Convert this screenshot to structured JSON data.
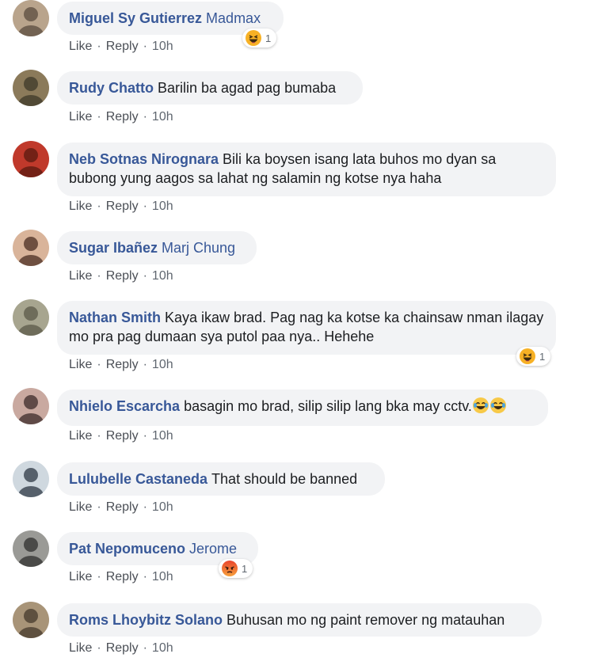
{
  "comments": [
    {
      "name": "Miguel Sy Gutierrez",
      "mention": "Madmax",
      "text": "",
      "like": "Like",
      "reply": "Reply",
      "time": "10h",
      "reaction": {
        "type": "haha",
        "count": "1"
      },
      "avatar_colors": [
        "#b9a48c",
        "#5b4c3f"
      ]
    },
    {
      "name": "Rudy Chatto",
      "mention": "",
      "text": "Barilin ba agad pag bumaba",
      "like": "Like",
      "reply": "Reply",
      "time": "10h",
      "avatar_colors": [
        "#8b7a5a",
        "#3e3a2a"
      ]
    },
    {
      "name": "Neb Sotnas Nirognara",
      "mention": "",
      "text": "Bili ka boysen isang lata buhos mo dyan sa bubong yung aagos sa lahat ng salamin ng kotse nya haha",
      "like": "Like",
      "reply": "Reply",
      "time": "10h",
      "avatar_colors": [
        "#c0392b",
        "#5a1a10"
      ]
    },
    {
      "name": "Sugar Ibañez",
      "mention": "Marj Chung",
      "text": "",
      "like": "Like",
      "reply": "Reply",
      "time": "10h",
      "avatar_colors": [
        "#d9b49a",
        "#4a2e22"
      ]
    },
    {
      "name": "Nathan Smith",
      "mention": "",
      "text": "Kaya ikaw brad. Pag nag ka kotse ka chainsaw nman ilagay mo pra pag dumaan sya putol paa nya.. Hehehe",
      "like": "Like",
      "reply": "Reply",
      "time": "10h",
      "reaction": {
        "type": "haha",
        "count": "1"
      },
      "avatar_colors": [
        "#a7a58f",
        "#5b5a48"
      ]
    },
    {
      "name": "Nhielo Escarcha",
      "mention": "",
      "text": "basagin mo brad, silip silip lang bka may cctv.",
      "like": "Like",
      "reply": "Reply",
      "time": "10h",
      "avatar_colors": [
        "#c9a9a0",
        "#3b2b2a"
      ]
    },
    {
      "name": "Lulubelle Castaneda",
      "mention": "",
      "text": "That should be banned",
      "like": "Like",
      "reply": "Reply",
      "time": "10h",
      "avatar_colors": [
        "#cfd8df",
        "#2e3844"
      ]
    },
    {
      "name": "Pat Nepomuceno",
      "mention": "Jerome",
      "text": "",
      "like": "Like",
      "reply": "Reply",
      "time": "10h",
      "reaction": {
        "type": "angry",
        "count": "1"
      },
      "avatar_colors": [
        "#9a9a96",
        "#2f2f2d"
      ]
    },
    {
      "name": "Roms Lhoybitz Solano",
      "mention": "",
      "text": "Buhusan mo ng paint remover ng matauhan",
      "like": "Like",
      "reply": "Reply",
      "time": "10h",
      "avatar_colors": [
        "#a89478",
        "#463a2c"
      ]
    }
  ]
}
